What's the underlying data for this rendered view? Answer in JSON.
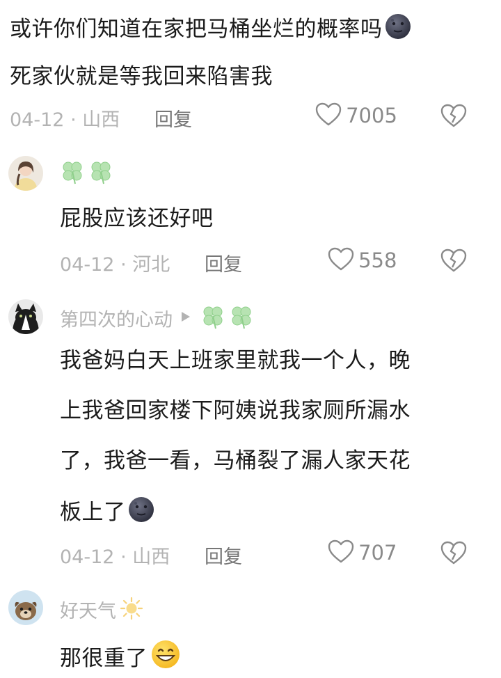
{
  "comments": [
    {
      "lines": [
        "或许你们知道在家把马桶坐烂的概率吗",
        "死家伙就是等我回来陷害我"
      ],
      "date": "04-12",
      "sep": "·",
      "location": "山西",
      "reply_label": "回复",
      "likes": "7005"
    },
    {
      "username": "",
      "lines": [
        "屁股应该还好吧"
      ],
      "date": "04-12",
      "sep": "·",
      "location": "河北",
      "reply_label": "回复",
      "likes": "558"
    },
    {
      "username": "第四次的心动",
      "lines": [
        "我爸妈白天上班家里就我一个人，晚",
        "上我爸回家楼下阿姨说我家厕所漏水",
        "了，我爸一看，马桶裂了漏人家天花",
        "板上了"
      ],
      "date": "04-12",
      "sep": "·",
      "location": "山西",
      "reply_label": "回复",
      "likes": "707"
    },
    {
      "username": "好天气",
      "lines": [
        "那很重了"
      ]
    }
  ],
  "icons": {
    "like": "heart-outline-icon",
    "dislike": "broken-heart-icon",
    "badge": "clover-icon",
    "moon": "new-moon-face-icon",
    "sun": "sun-icon",
    "smile": "grinning-face-icon"
  },
  "colors": {
    "text": "#1b1b1b",
    "meta": "#b3b3b3",
    "clover": "#9bd49a"
  }
}
